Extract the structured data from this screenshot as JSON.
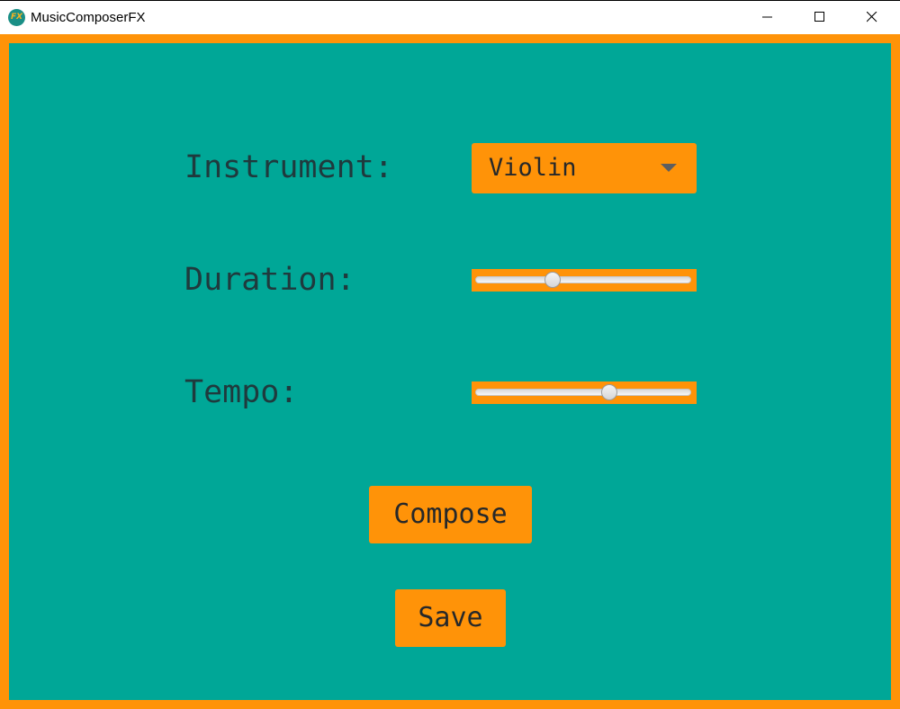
{
  "window": {
    "title": "MusicComposerFX",
    "icon_text": "FX"
  },
  "form": {
    "instrument_label": "Instrument:",
    "instrument_value": "Violin",
    "duration_label": "Duration:",
    "duration_value": 0.36,
    "tempo_label": "Tempo:",
    "tempo_value": 0.62
  },
  "actions": {
    "compose_label": "Compose",
    "save_label": "Save"
  },
  "colors": {
    "background": "#00a797",
    "accent": "#ff9308",
    "text": "#1f3a3d"
  }
}
